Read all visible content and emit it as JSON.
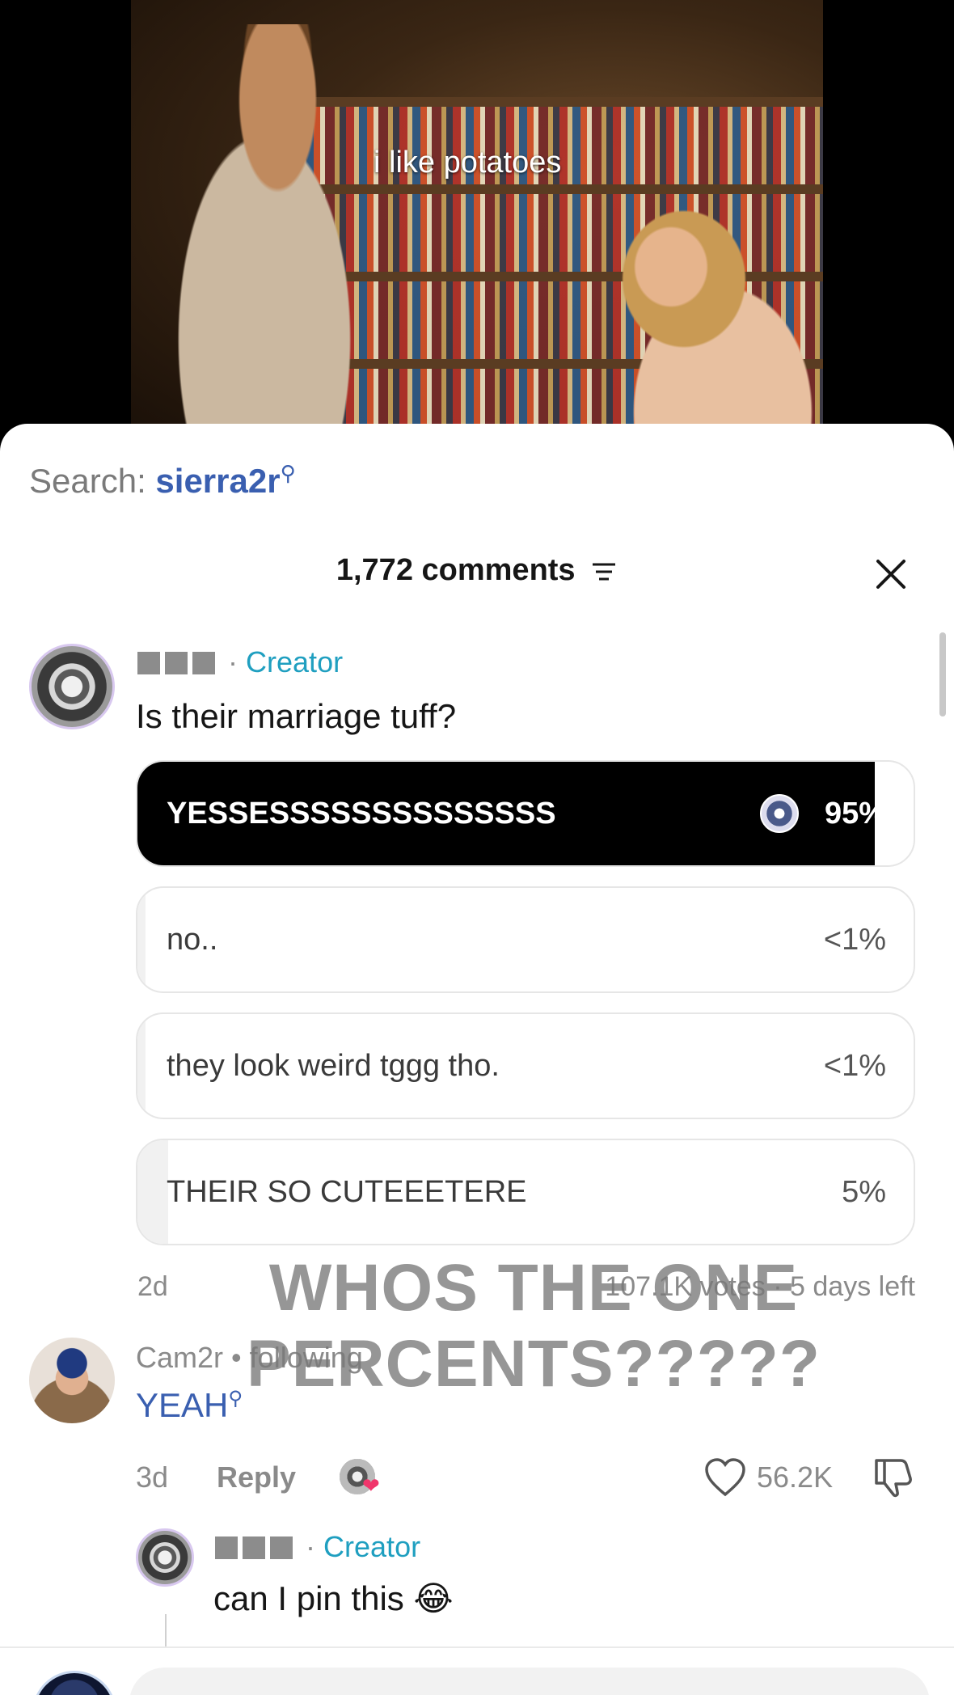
{
  "video": {
    "caption": "i like potatoes"
  },
  "search": {
    "prefix": "Search:",
    "query": "sierra2r"
  },
  "header": {
    "comment_count": "1,772 comments"
  },
  "colors": {
    "accent_link": "#3a5fb0",
    "creator_tag": "#1f9fc0",
    "heart": "#f0356b"
  },
  "comments": [
    {
      "author_tag": "Creator",
      "text": "Is their marriage tuff?",
      "poll": {
        "options": [
          {
            "label": "YESSESSSSSSSSSSSSSS",
            "percent": "95%",
            "fill": 0.95,
            "selected": true
          },
          {
            "label": "no..",
            "percent": "<1%",
            "fill": 0.01,
            "selected": false
          },
          {
            "label": "they look weird tggg tho.",
            "percent": "<1%",
            "fill": 0.01,
            "selected": false
          },
          {
            "label": "THEIR SO CUTEEETERE",
            "percent": "5%",
            "fill": 0.04,
            "selected": false
          }
        ],
        "age": "2d",
        "votes_text": "107.1K votes",
        "separator": "·",
        "time_left": "5 days left"
      }
    },
    {
      "author": "Cam2r",
      "relation": "following",
      "bullet": "•",
      "text": "YEAH",
      "age": "3d",
      "reply_label": "Reply",
      "likes": "56.2K"
    },
    {
      "author_tag": "Creator",
      "text": "can I pin this 😂"
    }
  ],
  "overlay": {
    "line1": "WHOS THE ONE",
    "line2": "PERCENTS?????"
  },
  "icons": [
    "search-icon",
    "filter-icon",
    "close-icon",
    "heart-icon",
    "dislike-icon"
  ]
}
